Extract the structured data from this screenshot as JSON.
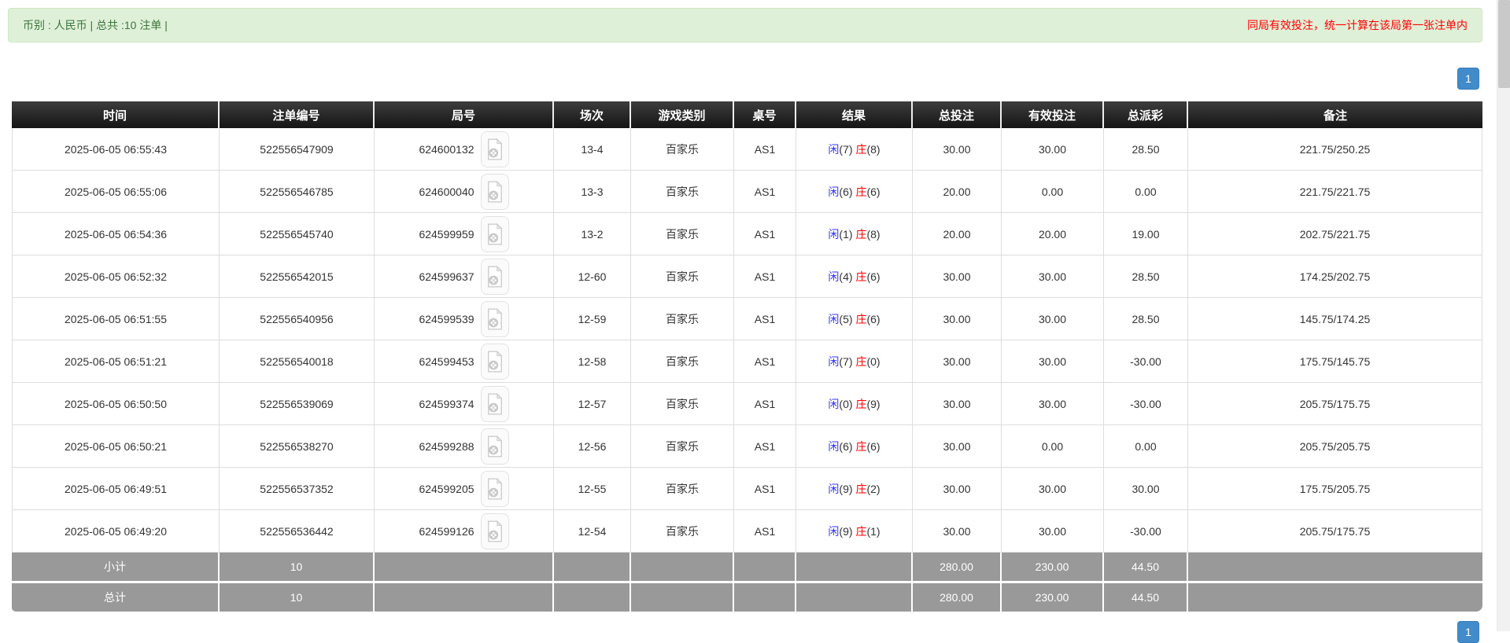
{
  "info_bar": {
    "left_text": "币别 : 人民币 | 总共 :10 注单 |",
    "right_note": "同局有效投注，统一计算在该局第一张注单内"
  },
  "pagination": {
    "page": "1"
  },
  "table": {
    "headers": [
      "时间",
      "注单编号",
      "局号",
      "场次",
      "游戏类别",
      "桌号",
      "结果",
      "总投注",
      "有效投注",
      "总派彩",
      "备注"
    ],
    "result_labels": {
      "xian": "闲",
      "zhuang": "庄"
    },
    "rows": [
      {
        "time": "2025-06-05 06:55:43",
        "bet_id": "522556547909",
        "round_id": "624600132",
        "session": "13-4",
        "game": "百家乐",
        "table_no": "AS1",
        "xian": "(7)",
        "zhuang": "(8)",
        "total_bet": "30.00",
        "valid_bet": "30.00",
        "payout": "28.50",
        "remark": "221.75/250.25"
      },
      {
        "time": "2025-06-05 06:55:06",
        "bet_id": "522556546785",
        "round_id": "624600040",
        "session": "13-3",
        "game": "百家乐",
        "table_no": "AS1",
        "xian": "(6)",
        "zhuang": "(6)",
        "total_bet": "20.00",
        "valid_bet": "0.00",
        "payout": "0.00",
        "remark": "221.75/221.75"
      },
      {
        "time": "2025-06-05 06:54:36",
        "bet_id": "522556545740",
        "round_id": "624599959",
        "session": "13-2",
        "game": "百家乐",
        "table_no": "AS1",
        "xian": "(1)",
        "zhuang": "(8)",
        "total_bet": "20.00",
        "valid_bet": "20.00",
        "payout": "19.00",
        "remark": "202.75/221.75"
      },
      {
        "time": "2025-06-05 06:52:32",
        "bet_id": "522556542015",
        "round_id": "624599637",
        "session": "12-60",
        "game": "百家乐",
        "table_no": "AS1",
        "xian": "(4)",
        "zhuang": "(6)",
        "total_bet": "30.00",
        "valid_bet": "30.00",
        "payout": "28.50",
        "remark": "174.25/202.75"
      },
      {
        "time": "2025-06-05 06:51:55",
        "bet_id": "522556540956",
        "round_id": "624599539",
        "session": "12-59",
        "game": "百家乐",
        "table_no": "AS1",
        "xian": "(5)",
        "zhuang": "(6)",
        "total_bet": "30.00",
        "valid_bet": "30.00",
        "payout": "28.50",
        "remark": "145.75/174.25"
      },
      {
        "time": "2025-06-05 06:51:21",
        "bet_id": "522556540018",
        "round_id": "624599453",
        "session": "12-58",
        "game": "百家乐",
        "table_no": "AS1",
        "xian": "(7)",
        "zhuang": "(0)",
        "total_bet": "30.00",
        "valid_bet": "30.00",
        "payout": "-30.00",
        "remark": "175.75/145.75"
      },
      {
        "time": "2025-06-05 06:50:50",
        "bet_id": "522556539069",
        "round_id": "624599374",
        "session": "12-57",
        "game": "百家乐",
        "table_no": "AS1",
        "xian": "(0)",
        "zhuang": "(9)",
        "total_bet": "30.00",
        "valid_bet": "30.00",
        "payout": "-30.00",
        "remark": "205.75/175.75"
      },
      {
        "time": "2025-06-05 06:50:21",
        "bet_id": "522556538270",
        "round_id": "624599288",
        "session": "12-56",
        "game": "百家乐",
        "table_no": "AS1",
        "xian": "(6)",
        "zhuang": "(6)",
        "total_bet": "30.00",
        "valid_bet": "0.00",
        "payout": "0.00",
        "remark": "205.75/205.75"
      },
      {
        "time": "2025-06-05 06:49:51",
        "bet_id": "522556537352",
        "round_id": "624599205",
        "session": "12-55",
        "game": "百家乐",
        "table_no": "AS1",
        "xian": "(9)",
        "zhuang": "(2)",
        "total_bet": "30.00",
        "valid_bet": "30.00",
        "payout": "30.00",
        "remark": "175.75/205.75"
      },
      {
        "time": "2025-06-05 06:49:20",
        "bet_id": "522556536442",
        "round_id": "624599126",
        "session": "12-54",
        "game": "百家乐",
        "table_no": "AS1",
        "xian": "(9)",
        "zhuang": "(1)",
        "total_bet": "30.00",
        "valid_bet": "30.00",
        "payout": "-30.00",
        "remark": "205.75/175.75"
      }
    ],
    "subtotal": {
      "label": "小计",
      "count": "10",
      "total_bet": "280.00",
      "valid_bet": "230.00",
      "payout": "44.50"
    },
    "total": {
      "label": "总计",
      "count": "10",
      "total_bet": "280.00",
      "valid_bet": "230.00",
      "payout": "44.50"
    }
  },
  "icons": {
    "round_video": "video-file-icon"
  },
  "colors": {
    "info_bg": "#dff0d8",
    "info_border": "#d0e6c2",
    "info_text_green": "#3c763d",
    "note_red": "#ff0000",
    "link_blue": "#2a6fdd",
    "xian_blue": "#3333ff",
    "zhuang_red": "#ff0000",
    "negative_red": "#ff0000",
    "header_bg": "#222222",
    "summary_bg": "#999999",
    "pager_blue": "#428bca",
    "row_border": "#dddddd"
  }
}
